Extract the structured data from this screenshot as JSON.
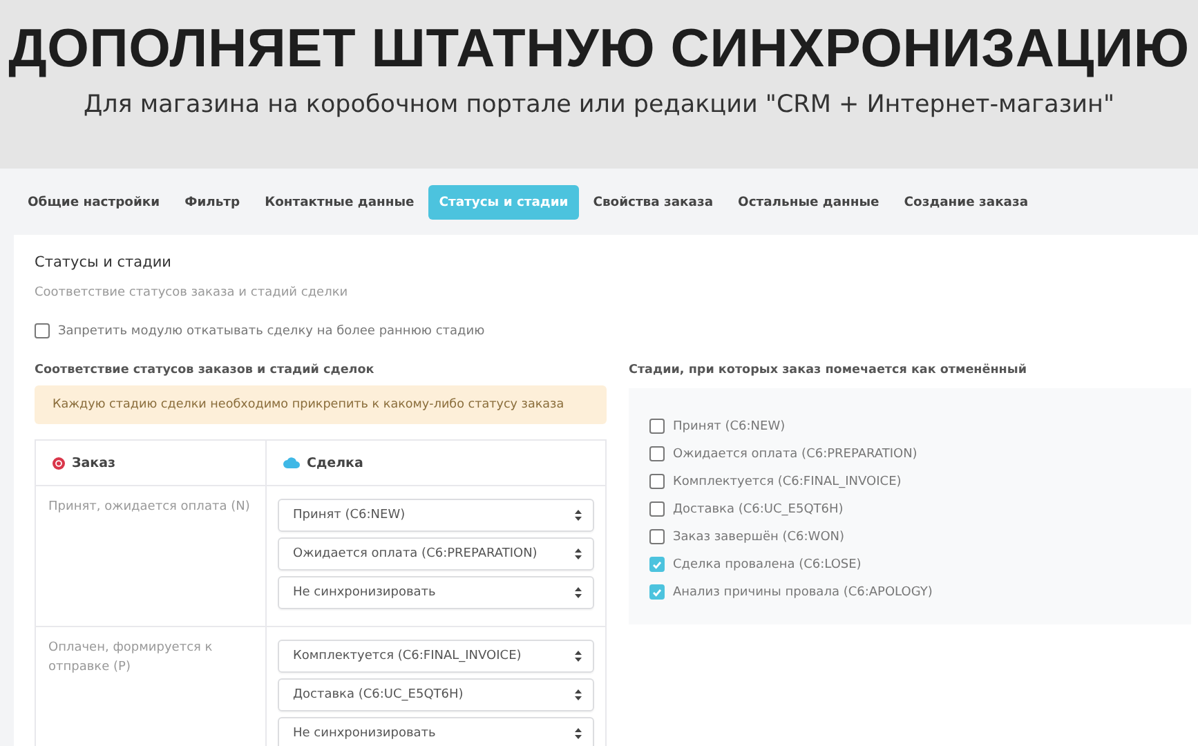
{
  "banner": {
    "title": "ДОПОЛНЯЕТ ШТАТНУЮ СИНХРОНИЗАЦИЮ",
    "subtitle": "Для магазина на коробочном портале или редакции \"CRM + Интернет-магазин\""
  },
  "tabs": [
    {
      "label": "Общие настройки",
      "selected": false
    },
    {
      "label": "Фильтр",
      "selected": false
    },
    {
      "label": "Контактные данные",
      "selected": false
    },
    {
      "label": "Статусы и стадии",
      "selected": true
    },
    {
      "label": "Свойства заказа",
      "selected": false
    },
    {
      "label": "Остальные данные",
      "selected": false
    },
    {
      "label": "Создание заказа",
      "selected": false
    }
  ],
  "section": {
    "title": "Статусы и стадии",
    "description": "Соответствие статусов заказа и стадий сделки",
    "rollback_option": {
      "label": "Запретить модулю откатывать сделку на более раннюю стадию",
      "checked": false
    }
  },
  "mapping": {
    "title": "Соответствие статусов заказов и стадий сделок",
    "notice": "Каждую стадию сделки необходимо прикрепить к какому-либо статусу заказа",
    "columns": [
      "Заказ",
      "Сделка"
    ],
    "rows": [
      {
        "status": "Принят, ожидается оплата (N)",
        "stages": [
          "Принят (C6:NEW)",
          "Ожидается оплата (C6:PREPARATION)",
          "Не синхронизировать"
        ]
      },
      {
        "status": "Оплачен, формируется к отправке (P)",
        "stages": [
          "Комплектуется (C6:FINAL_INVOICE)",
          "Доставка (C6:UC_E5QT6H)",
          "Не синхронизировать"
        ]
      }
    ]
  },
  "cancel_stages": {
    "title": "Стадии, при которых заказ помечается как отменённый",
    "items": [
      {
        "label": "Принят (C6:NEW)",
        "checked": false
      },
      {
        "label": "Ожидается оплата (C6:PREPARATION)",
        "checked": false
      },
      {
        "label": "Комплектуется (C6:FINAL_INVOICE)",
        "checked": false
      },
      {
        "label": "Доставка (C6:UC_E5QT6H)",
        "checked": false
      },
      {
        "label": "Заказ завершён (C6:WON)",
        "checked": false
      },
      {
        "label": "Сделка провалена (C6:LOSE)",
        "checked": true
      },
      {
        "label": "Анализ причины провала (C6:APOLOGY)",
        "checked": true
      }
    ]
  }
}
